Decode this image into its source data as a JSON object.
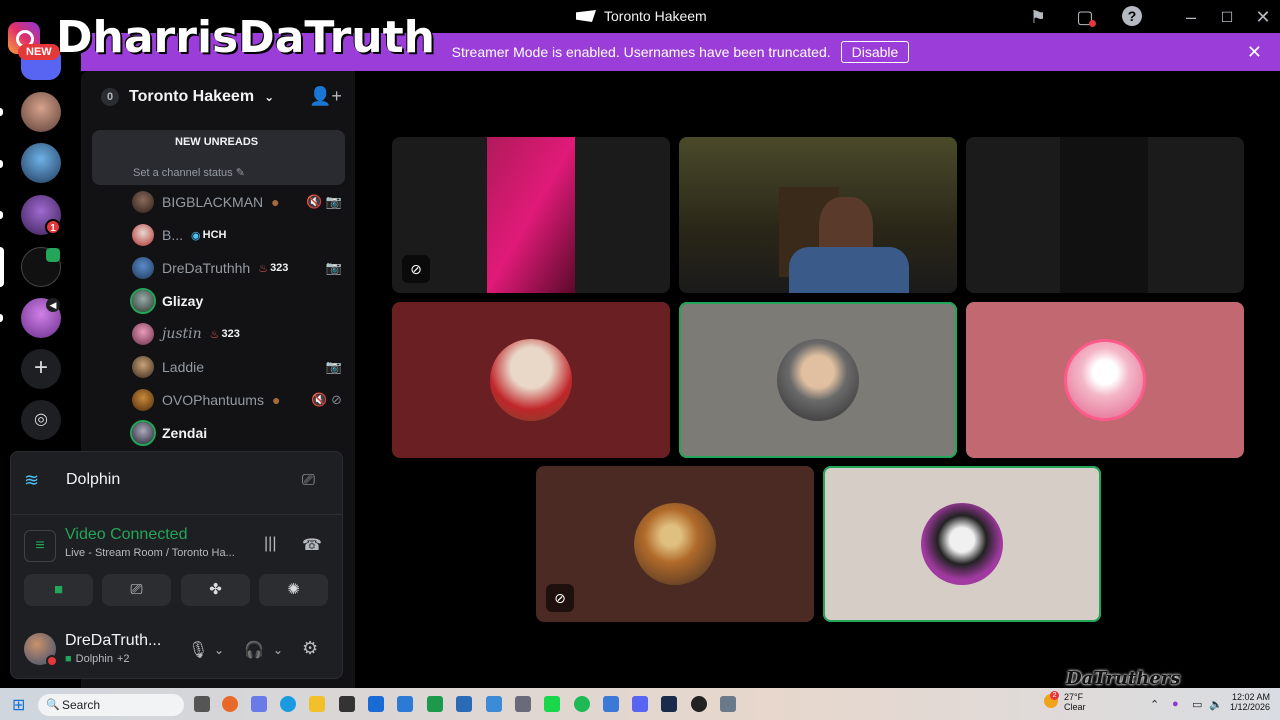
{
  "window": {
    "title": "Toronto Hakeem",
    "title_icon": "discord-flag-icon"
  },
  "overlay": {
    "watermark": "DharrisDaTruth",
    "new_badge": "NEW"
  },
  "banner": {
    "text": "Streamer Mode is enabled. Usernames have been truncated.",
    "disable_label": "Disable"
  },
  "rail": {
    "badge_count": "1"
  },
  "server": {
    "name": "Toronto Hakeem",
    "badge": "0"
  },
  "unreads": {
    "label": "NEW UNREADS",
    "channel_status": "Set a channel status"
  },
  "members": [
    {
      "name": "BIGBLACKMAN",
      "tag": "",
      "icons": "🔇 📷"
    },
    {
      "name": "B...",
      "tag": "HCH",
      "icons": ""
    },
    {
      "name": "DreDaTruthhh",
      "tag": "323",
      "icons": "📷"
    },
    {
      "name": "Glizay",
      "tag": "",
      "icons": ""
    },
    {
      "name": "justin",
      "tag": "323",
      "icons": ""
    },
    {
      "name": "Laddie",
      "tag": "",
      "icons": "📷"
    },
    {
      "name": "OVOPhantuums",
      "tag": "",
      "icons": "🔇 ⊘"
    },
    {
      "name": "Zendai",
      "tag": "",
      "icons": ""
    }
  ],
  "activity": {
    "game": "Dolphin"
  },
  "voice": {
    "status": "Video Connected",
    "location": "Live - Stream Room / Toronto Ha..."
  },
  "user": {
    "name": "DreDaTruth...",
    "activity": "Dolphin",
    "extra": "+2"
  },
  "main_logo": "DaTruthers",
  "taskbar": {
    "search_placeholder": "Search",
    "weather_temp": "27°F",
    "weather_desc": "Clear",
    "weather_badge": "2",
    "time": "12:02 AM",
    "date": "1/12/2026"
  }
}
